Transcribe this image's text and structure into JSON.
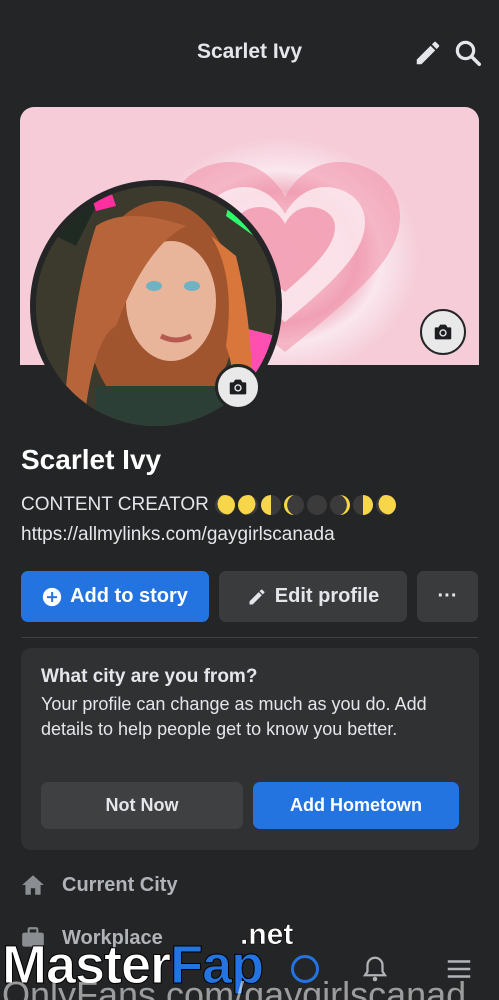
{
  "header": {
    "title": "Scarlet Ivy",
    "edit_icon": "pencil-icon",
    "search_icon": "search-icon"
  },
  "profile": {
    "name": "Scarlet Ivy",
    "bio": "CONTENT CREATOR",
    "bio_emoji": [
      "waxing-gibbous-moon",
      "waning-gibbous-moon",
      "last-quarter-moon",
      "waning-crescent-moon",
      "new-moon",
      "waxing-crescent-moon",
      "first-quarter-moon",
      "waxing-gibbous-moon"
    ],
    "link": "https://allmylinks.com/gaygirlscanada"
  },
  "actions": {
    "add_story": "Add to story",
    "edit_profile": "Edit profile",
    "more": "···"
  },
  "prompt_card": {
    "question": "What city are you from?",
    "description": "Your profile can change as much as you do. Add details to help people get to know you better.",
    "not_now": "Not Now",
    "add_hometown": "Add Hometown"
  },
  "details": {
    "current_city": "Current City",
    "workplace": "Workplace"
  },
  "watermark": {
    "brand_master": "Master",
    "brand_fap": "Fap",
    "brand_net": ".net",
    "url": "OnlyFans.com/gaygirlscanad"
  },
  "colors": {
    "background": "#242526",
    "accent": "#2374e1",
    "secondary_button": "#3a3b3c"
  }
}
